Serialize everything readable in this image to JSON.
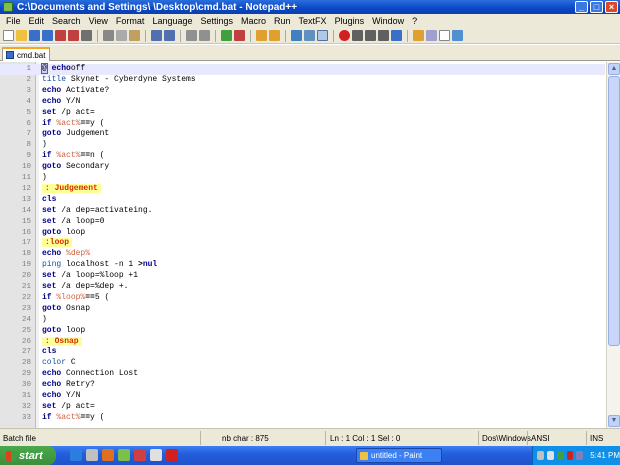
{
  "window": {
    "title": "C:\\Documents and Settings\\                    \\Desktop\\cmd.bat - Notepad++"
  },
  "menu": [
    "File",
    "Edit",
    "Search",
    "View",
    "Format",
    "Language",
    "Settings",
    "Macro",
    "Run",
    "TextFX",
    "Plugins",
    "Window",
    "?"
  ],
  "tab": {
    "label": "cmd.bat"
  },
  "lines": [
    {
      "n": "1",
      "segs": [
        [
          "caret",
          "@"
        ],
        [
          "kw",
          " echo"
        ],
        [
          "",
          "off"
        ]
      ]
    },
    {
      "n": "2",
      "segs": [
        [
          "kw2",
          "title"
        ],
        [
          "",
          " Skynet - Cyberdyne Systems"
        ]
      ]
    },
    {
      "n": "3",
      "segs": [
        [
          "kw",
          "echo"
        ],
        [
          "",
          " Activate?"
        ]
      ]
    },
    {
      "n": "4",
      "segs": [
        [
          "kw",
          "echo"
        ],
        [
          "",
          " Y/N"
        ]
      ]
    },
    {
      "n": "5",
      "segs": [
        [
          "kw",
          "set"
        ],
        [
          "",
          " /p act="
        ]
      ]
    },
    {
      "n": "6",
      "segs": [
        [
          "kw",
          "if"
        ],
        [
          "",
          " "
        ],
        [
          "var",
          "%act%"
        ],
        [
          "op",
          "=="
        ],
        [
          "",
          "y ("
        ]
      ]
    },
    {
      "n": "7",
      "segs": [
        [
          "kw",
          "goto"
        ],
        [
          "",
          " Judgement"
        ]
      ]
    },
    {
      "n": "8",
      "segs": [
        [
          "",
          ")"
        ]
      ]
    },
    {
      "n": "9",
      "segs": [
        [
          "kw",
          "if"
        ],
        [
          "",
          " "
        ],
        [
          "var",
          "%act%"
        ],
        [
          "op",
          "=="
        ],
        [
          "",
          "n ("
        ]
      ]
    },
    {
      "n": "10",
      "segs": [
        [
          "kw",
          "goto"
        ],
        [
          "",
          " Secondary"
        ]
      ]
    },
    {
      "n": "11",
      "segs": [
        [
          "",
          ")"
        ]
      ]
    },
    {
      "n": "12",
      "segs": [
        [
          "lab",
          ": Judgement"
        ]
      ]
    },
    {
      "n": "13",
      "segs": [
        [
          "kw",
          "cls"
        ]
      ]
    },
    {
      "n": "14",
      "segs": [
        [
          "kw",
          "set"
        ],
        [
          "",
          " /a dep=activateing."
        ]
      ]
    },
    {
      "n": "15",
      "segs": [
        [
          "kw",
          "set"
        ],
        [
          "",
          " /a loop=0"
        ]
      ]
    },
    {
      "n": "16",
      "segs": [
        [
          "kw",
          "goto"
        ],
        [
          "",
          " loop"
        ]
      ]
    },
    {
      "n": "17",
      "segs": [
        [
          "lab",
          ":loop"
        ]
      ]
    },
    {
      "n": "18",
      "segs": [
        [
          "kw",
          "echo"
        ],
        [
          "",
          " "
        ],
        [
          "var",
          "%dep%"
        ]
      ]
    },
    {
      "n": "19",
      "segs": [
        [
          "kw2",
          "ping"
        ],
        [
          "",
          " localhost -n 1 "
        ],
        [
          "op",
          ">"
        ],
        [
          "kw",
          "nul"
        ]
      ]
    },
    {
      "n": "20",
      "segs": [
        [
          "kw",
          "set"
        ],
        [
          "",
          " /a loop=%loop +1"
        ]
      ]
    },
    {
      "n": "21",
      "segs": [
        [
          "kw",
          "set"
        ],
        [
          "",
          " /a dep=%dep +."
        ]
      ]
    },
    {
      "n": "22",
      "segs": [
        [
          "kw",
          "if"
        ],
        [
          "",
          " "
        ],
        [
          "var",
          "%loop%"
        ],
        [
          "op",
          "=="
        ],
        [
          "",
          "5 ("
        ]
      ]
    },
    {
      "n": "23",
      "segs": [
        [
          "kw",
          "goto"
        ],
        [
          "",
          " Osnap"
        ]
      ]
    },
    {
      "n": "24",
      "segs": [
        [
          "",
          ")"
        ]
      ]
    },
    {
      "n": "25",
      "segs": [
        [
          "kw",
          "goto"
        ],
        [
          "",
          " loop"
        ]
      ]
    },
    {
      "n": "26",
      "segs": [
        [
          "lab",
          ": Osnap"
        ]
      ]
    },
    {
      "n": "27",
      "segs": [
        [
          "kw",
          "cls"
        ]
      ]
    },
    {
      "n": "28",
      "segs": [
        [
          "kw2",
          "color"
        ],
        [
          "",
          " C"
        ]
      ]
    },
    {
      "n": "29",
      "segs": [
        [
          "kw",
          "echo"
        ],
        [
          "",
          " Connection Lost"
        ]
      ]
    },
    {
      "n": "30",
      "segs": [
        [
          "kw",
          "echo"
        ],
        [
          "",
          " Retry?"
        ]
      ]
    },
    {
      "n": "31",
      "segs": [
        [
          "kw",
          "echo"
        ],
        [
          "",
          " Y/N"
        ]
      ]
    },
    {
      "n": "32",
      "segs": [
        [
          "kw",
          "set"
        ],
        [
          "",
          " /p act="
        ]
      ]
    },
    {
      "n": "33",
      "segs": [
        [
          "kw",
          "if"
        ],
        [
          "",
          " "
        ],
        [
          "var",
          "%act%"
        ],
        [
          "op",
          "=="
        ],
        [
          "",
          "y ("
        ]
      ]
    }
  ],
  "status": {
    "filetype": "Batch file",
    "nbchar": "nb char : 875",
    "position": "Ln : 1   Col : 1   Sel : 0",
    "eol": "Dos\\Windows",
    "encoding": "ANSI",
    "mode": "INS"
  },
  "taskbar": {
    "start_label": "start",
    "task_label": "untitled - Paint",
    "clock": "5:41 PM"
  },
  "colors": {
    "titlebar": "#0a47c4",
    "keyword": "#00008b",
    "variable": "#d06040",
    "label_highlight": "#ffff99",
    "taskbar": "#245edb"
  }
}
